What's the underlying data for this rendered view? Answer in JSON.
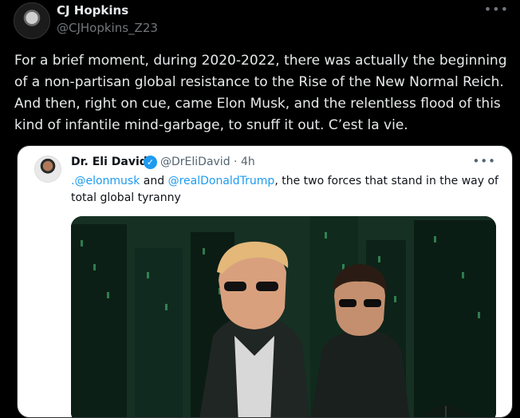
{
  "post": {
    "author": "CJ Hopkins",
    "handle": "@CJHopkins_Z23",
    "text": "For a brief moment, during 2020-2022, there was actually the beginning of a non-partisan global resistance to the Rise of the New Normal Reich. And then, right on cue, came Elon Musk, and the relentless flood of this kind of infantile mind-garbage, to snuff it out. C’est la vie.",
    "more_icon": "more-icon"
  },
  "quoted_post": {
    "author": "Dr. Eli David",
    "handle": "@DrEliDavid",
    "time": "4h",
    "separator": "·",
    "mention_1": ".@elonmusk",
    "and_text": " and ",
    "mention_2": "@realDonaldTrump",
    "rest_text": ", the two forces that stand in the way of total global tyranny",
    "verified_icon": "verified-badge-icon",
    "image_description_text": ""
  },
  "colors": {
    "background": "#000000",
    "text": "#e7e9ea",
    "muted": "#71767b",
    "link": "#1d9bf0",
    "card_bg": "#ffffff"
  }
}
